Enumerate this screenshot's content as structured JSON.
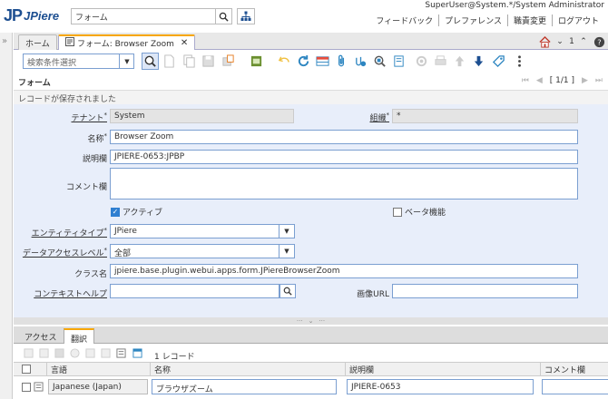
{
  "header": {
    "logo_mark": "JP",
    "logo_text": "JPiere",
    "menu_search_value": "フォーム",
    "user": "SuperUser@System.*/System Administrator",
    "links": [
      "フィードバック",
      "プレファレンス",
      "職責変更",
      "ログアウト"
    ]
  },
  "tabs": {
    "home": "ホーム",
    "active": "フォーム: Browser Zoom",
    "count": "1"
  },
  "toolbar": {
    "search_placeholder": "検索条件選択"
  },
  "window": {
    "title": "フォーム",
    "record_count": "[ 1/1 ]",
    "status": "レコードが保存されました"
  },
  "form": {
    "tenant_label": "テナント",
    "tenant_value": "System",
    "org_label": "組織",
    "org_value": "*",
    "name_label": "名称",
    "name_value": "Browser Zoom",
    "desc_label": "説明欄",
    "desc_value": "JPIERE-0653:JPBP",
    "comment_label": "コメント欄",
    "comment_value": "",
    "active_label": "アクティブ",
    "active_checked": true,
    "beta_label": "ベータ機能",
    "beta_checked": false,
    "entity_label": "エンティティタイプ",
    "entity_value": "JPiere",
    "access_label": "データアクセスレベル",
    "access_value": "全部",
    "class_label": "クラス名",
    "class_value": "jpiere.base.plugin.webui.apps.form.JPiereBrowserZoom",
    "context_help_label": "コンテキストヘルプ",
    "context_help_value": "",
    "image_url_label": "画像URL",
    "image_url_value": ""
  },
  "detail": {
    "tabs": [
      "アクセス",
      "翻訳"
    ],
    "record_count": "1 レコード",
    "columns": [
      "言語",
      "名称",
      "説明欄",
      "コメント欄"
    ],
    "rows": [
      {
        "language": "Japanese (Japan)",
        "name": "ブラウザズーム",
        "description": "JPIERE-0653",
        "comment": ""
      }
    ]
  },
  "colors": {
    "brand": "#1d4f91",
    "form_bg": "#e8eefa",
    "field_border": "#7b9fd1",
    "tab_accent": "#f7a600"
  }
}
